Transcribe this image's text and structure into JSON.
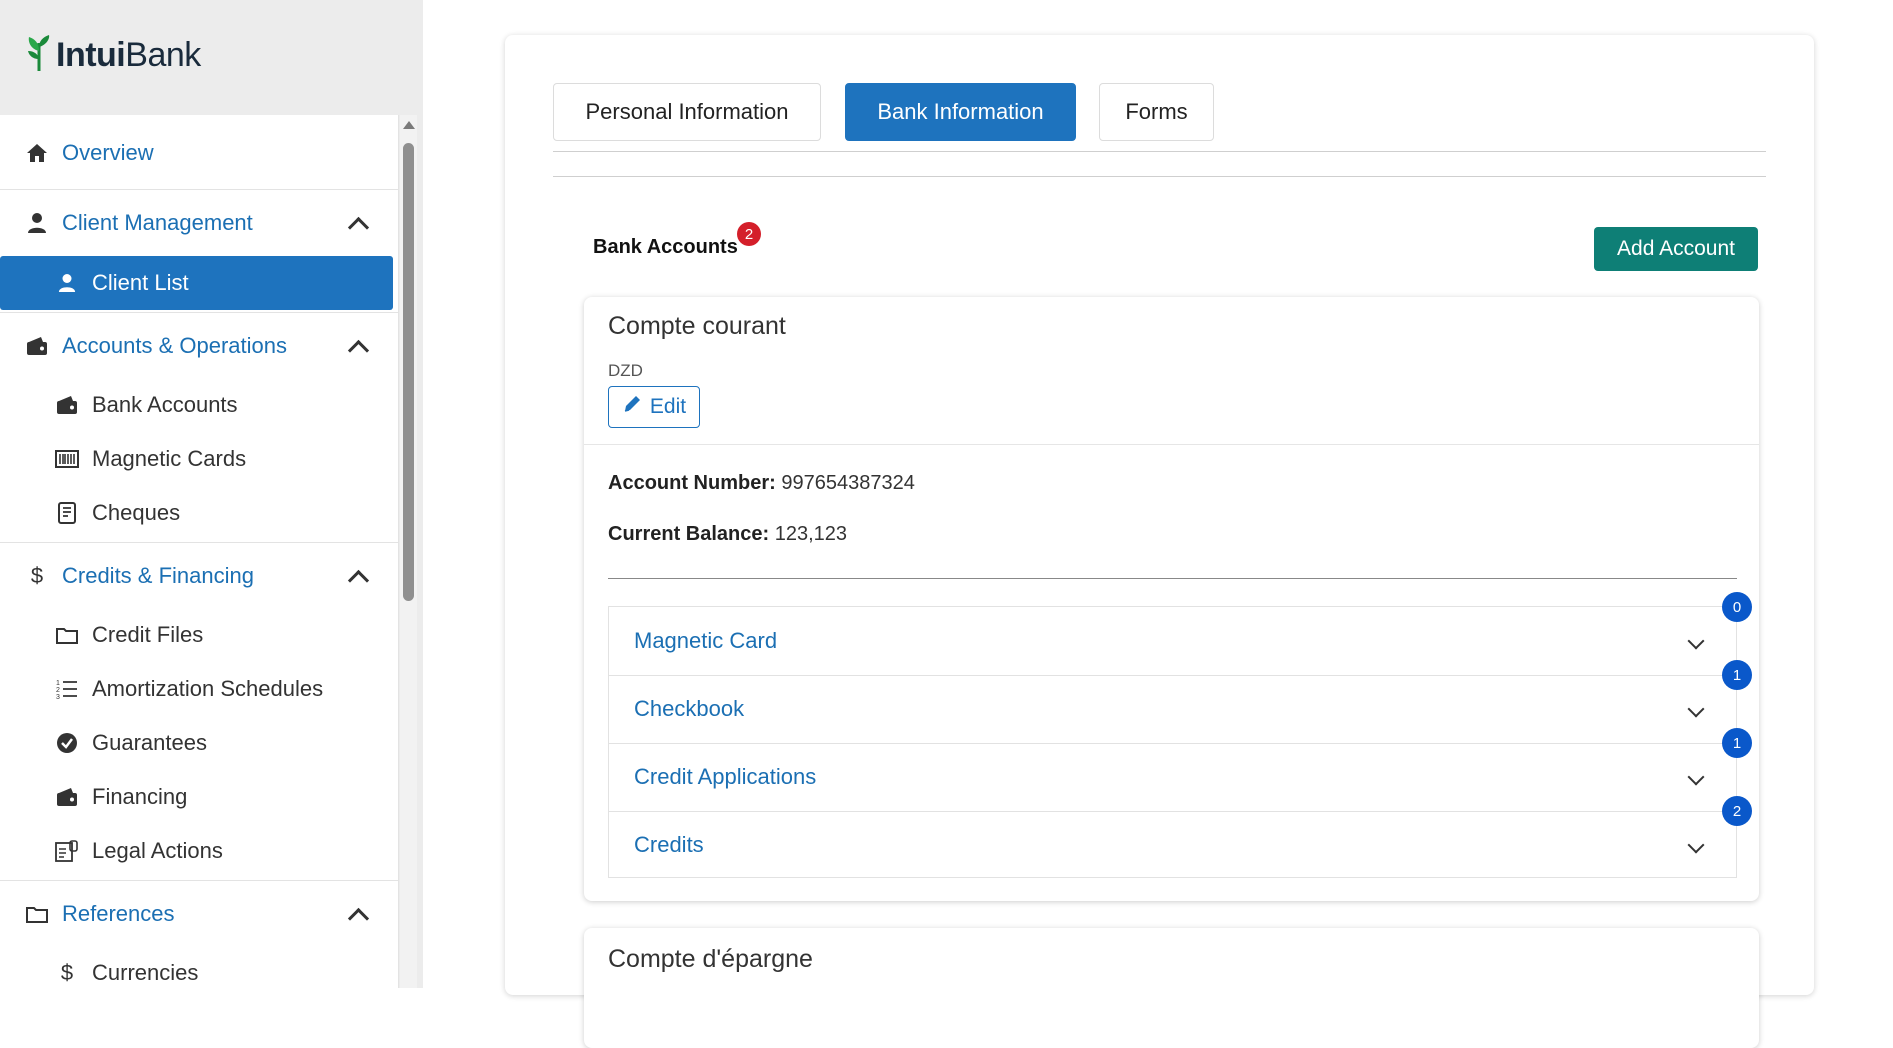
{
  "brand": {
    "logo_prefix": "Intui",
    "logo_suffix": "Bank"
  },
  "sidebar": {
    "overview": "Overview",
    "client_management": "Client Management",
    "client_list": "Client List",
    "accounts_operations": "Accounts & Operations",
    "bank_accounts": "Bank Accounts",
    "magnetic_cards": "Magnetic Cards",
    "cheques": "Cheques",
    "credits_financing": "Credits & Financing",
    "credit_files": "Credit Files",
    "amortization_schedules": "Amortization Schedules",
    "guarantees": "Guarantees",
    "financing": "Financing",
    "legal_actions": "Legal Actions",
    "references": "References",
    "currencies": "Currencies"
  },
  "tabs": {
    "personal": "Personal Information",
    "bank": "Bank Information",
    "forms": "Forms"
  },
  "bank_accounts": {
    "heading": "Bank Accounts",
    "count": "2",
    "add_button": "Add Account"
  },
  "account1": {
    "title": "Compte courant",
    "currency": "DZD",
    "edit": "Edit",
    "number_label": "Account Number:",
    "number_value": "997654387324",
    "balance_label": "Current Balance:",
    "balance_value": "123,123",
    "sections": [
      {
        "label": "Magnetic Card",
        "count": "0"
      },
      {
        "label": "Checkbook",
        "count": "1"
      },
      {
        "label": "Credit Applications",
        "count": "1"
      },
      {
        "label": "Credits",
        "count": "2"
      }
    ]
  },
  "account2": {
    "title": "Compte d'épargne"
  },
  "colors": {
    "primary": "#1e73be",
    "success": "#0e7f76",
    "danger": "#d41f2a",
    "badge": "#0a58ca"
  }
}
